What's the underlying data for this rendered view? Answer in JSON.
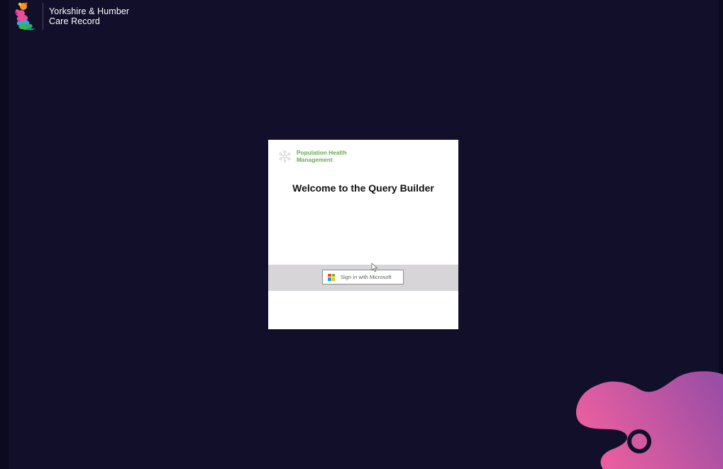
{
  "header": {
    "brand_line1": "Yorkshire & Humber",
    "brand_line2": "Care Record",
    "logo_icon": "yhcr-logo-icon"
  },
  "login_card": {
    "product_line1": "Population Health",
    "product_line2": "Management",
    "product_icon": "phm-network-icon",
    "welcome_heading": "Welcome to the Query Builder",
    "signin_button_label": "Sign in with Microsoft",
    "signin_icon": "microsoft-logo-icon"
  },
  "colors": {
    "background": "#110f2a",
    "card_background": "#ffffff",
    "product_green": "#6aa84f",
    "signin_band": "#d8d5d9",
    "blob_pink": "#ee5f9f",
    "blob_purple": "#9a4ea5",
    "microsoft_red": "#f25022",
    "microsoft_green": "#7fba00",
    "microsoft_blue": "#00a4ef",
    "microsoft_yellow": "#ffb900"
  }
}
